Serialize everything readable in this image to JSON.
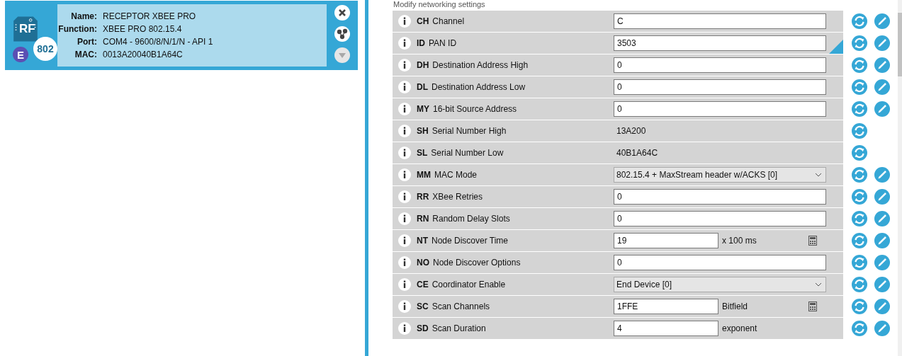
{
  "device": {
    "badge_top": "RF",
    "badge_corner": "E",
    "badge_number": "802",
    "fields": [
      {
        "label": "Name:",
        "value": "RECEPTOR XBEE PRO"
      },
      {
        "label": "Function:",
        "value": "XBEE PRO 802.15.4"
      },
      {
        "label": "Port:",
        "value": "COM4 - 9600/8/N/1/N - API 1"
      },
      {
        "label": "MAC:",
        "value": "0013A20040B1A64C"
      }
    ]
  },
  "section_title": "Modify networking settings",
  "settings": [
    {
      "code": "CH",
      "name": "Channel",
      "kind": "input",
      "value": "C",
      "writable": true,
      "modified": false
    },
    {
      "code": "ID",
      "name": "PAN ID",
      "kind": "input",
      "value": "3503",
      "writable": true,
      "modified": true
    },
    {
      "code": "DH",
      "name": "Destination Address High",
      "kind": "input",
      "value": "0",
      "writable": true,
      "modified": false
    },
    {
      "code": "DL",
      "name": "Destination Address Low",
      "kind": "input",
      "value": "0",
      "writable": true,
      "modified": false
    },
    {
      "code": "MY",
      "name": "16-bit Source Address",
      "kind": "input",
      "value": "0",
      "writable": true,
      "modified": false
    },
    {
      "code": "SH",
      "name": "Serial Number High",
      "kind": "readonly",
      "value": "13A200",
      "writable": false,
      "modified": false
    },
    {
      "code": "SL",
      "name": "Serial Number Low",
      "kind": "readonly",
      "value": "40B1A64C",
      "writable": false,
      "modified": false
    },
    {
      "code": "MM",
      "name": "MAC Mode",
      "kind": "select",
      "value": "802.15.4 + MaxStream header w/ACKS [0]",
      "writable": true,
      "modified": false
    },
    {
      "code": "RR",
      "name": "XBee Retries",
      "kind": "input",
      "value": "0",
      "writable": true,
      "modified": false
    },
    {
      "code": "RN",
      "name": "Random Delay Slots",
      "kind": "input",
      "value": "0",
      "writable": true,
      "modified": false
    },
    {
      "code": "NT",
      "name": "Node Discover Time",
      "kind": "unit",
      "value": "19",
      "unit": "x 100 ms",
      "calculator": true,
      "writable": true,
      "modified": false
    },
    {
      "code": "NO",
      "name": "Node Discover Options",
      "kind": "input",
      "value": "0",
      "writable": true,
      "modified": false
    },
    {
      "code": "CE",
      "name": "Coordinator Enable",
      "kind": "select",
      "value": "End Device [0]",
      "writable": true,
      "modified": false
    },
    {
      "code": "SC",
      "name": "Scan Channels",
      "kind": "unit",
      "value": "1FFE",
      "unit": "Bitfield",
      "calculator": true,
      "writable": true,
      "modified": false
    },
    {
      "code": "SD",
      "name": "Scan Duration",
      "kind": "unit",
      "value": "4",
      "unit": "exponent",
      "calculator": false,
      "writable": true,
      "modified": false
    }
  ]
}
